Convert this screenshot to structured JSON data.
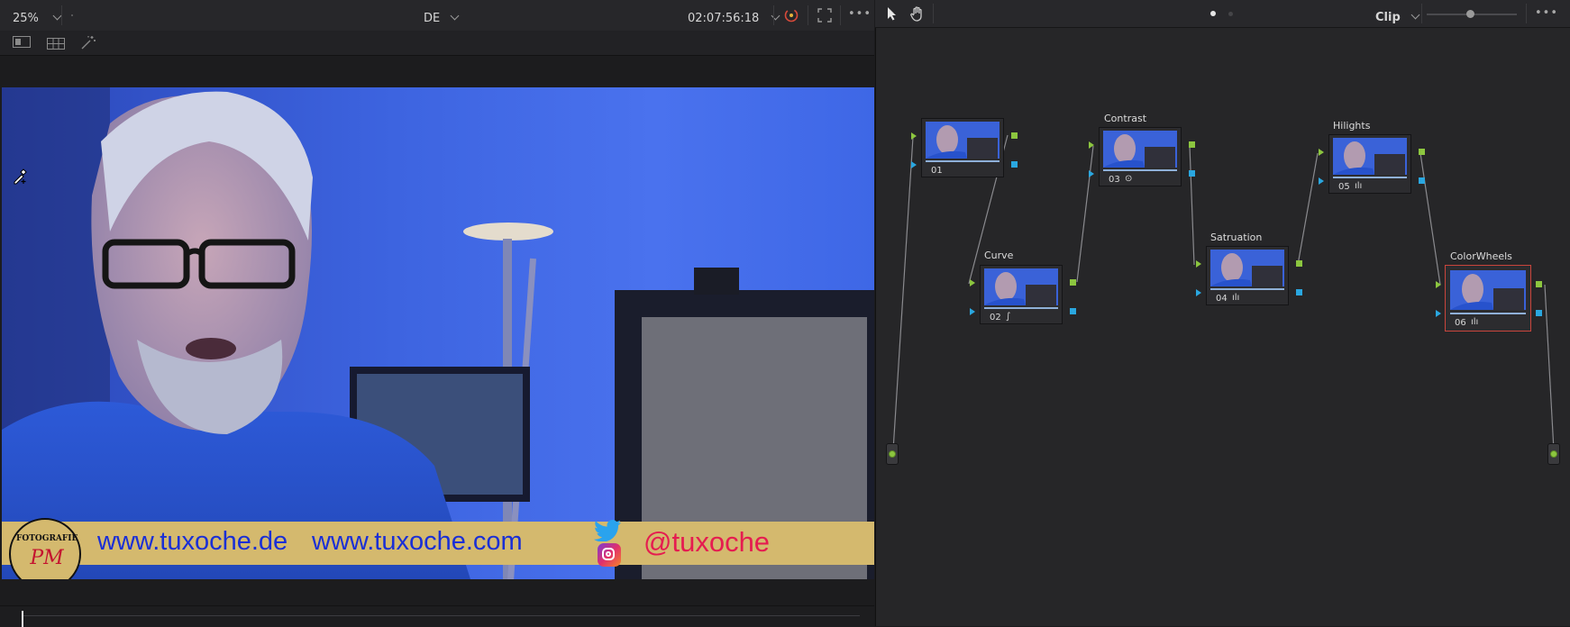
{
  "viewer": {
    "zoom": "25%",
    "title": "DE",
    "timecode": "02:07:56:18",
    "more": "•••"
  },
  "banner": {
    "logo_top": "FOTOGRAFIE",
    "logo_initials": "PM",
    "url_de": "www.tuxoche.de",
    "url_com": "www.tuxoche.com",
    "handle": "@tuxoche"
  },
  "node_editor": {
    "mode": "Clip",
    "more": "•••",
    "nodes": [
      {
        "number": "01",
        "label": "",
        "glyph": ""
      },
      {
        "number": "02",
        "label": "Curve",
        "glyph": "∫"
      },
      {
        "number": "03",
        "label": "Contrast",
        "glyph": "⊙"
      },
      {
        "number": "04",
        "label": "Satruation",
        "glyph": "ılı"
      },
      {
        "number": "05",
        "label": "Hilights",
        "glyph": "ılı"
      },
      {
        "number": "06",
        "label": "ColorWheels",
        "glyph": "ılı"
      }
    ]
  },
  "colors": {
    "accent_green": "#8cc63f",
    "accent_blue": "#2aa7e0",
    "selected_node": "#c9453c",
    "banner_gold": "#d4b96e",
    "banner_text_blue": "#1a2fd6",
    "banner_text_red": "#e51c50"
  }
}
